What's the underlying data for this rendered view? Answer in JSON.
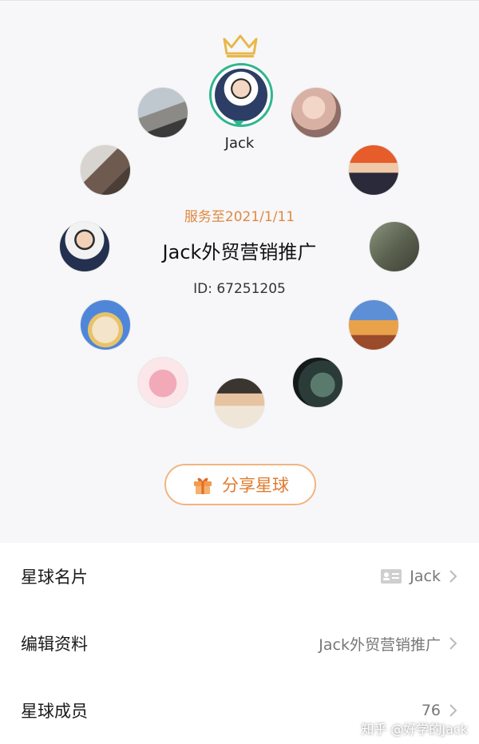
{
  "owner": {
    "name": "Jack",
    "crown_color": "#e7b84a",
    "ring_color": "#2fb68e"
  },
  "members": [
    {
      "name": "member-avatar-1",
      "colors": [
        "#e9d7cf",
        "#c49a8e"
      ]
    },
    {
      "name": "member-avatar-2",
      "colors": [
        "#e65c2a",
        "#2a2a3a"
      ]
    },
    {
      "name": "member-avatar-3",
      "colors": [
        "#6f7a68",
        "#3d3f36"
      ]
    },
    {
      "name": "member-avatar-4",
      "colors": [
        "#e9a24a",
        "#9a4b2b"
      ]
    },
    {
      "name": "member-avatar-5",
      "colors": [
        "#3a4c48",
        "#141a1a"
      ]
    },
    {
      "name": "member-avatar-6",
      "colors": [
        "#f0e6d8",
        "#3a3530"
      ]
    },
    {
      "name": "member-avatar-7",
      "colors": [
        "#fbe6ea",
        "#f2a9b8"
      ]
    },
    {
      "name": "member-avatar-8",
      "colors": [
        "#4f86d9",
        "#f4e4c9"
      ]
    },
    {
      "name": "member-avatar-9",
      "colors": [
        "#f2f2f2",
        "#23304f"
      ]
    },
    {
      "name": "member-avatar-10",
      "colors": [
        "#d8d4cf",
        "#4a3e36"
      ]
    },
    {
      "name": "member-avatar-11",
      "colors": [
        "#bfc7cf",
        "#3a3a3a"
      ]
    }
  ],
  "center": {
    "expire": "服务至2021/1/11",
    "title": "Jack外贸营销推广",
    "id": "ID: 67251205"
  },
  "share_button": {
    "label": "分享星球"
  },
  "rows": [
    {
      "label": "星球名片",
      "value": "Jack"
    },
    {
      "label": "编辑资料",
      "value": "Jack外贸营销推广"
    },
    {
      "label": "星球成员",
      "value": "76"
    }
  ],
  "watermark": "知乎 @好学的Jack",
  "colors": {
    "accent": "#e07a2e",
    "expire_text": "#e0883f",
    "share_border": "#f3b47f"
  }
}
